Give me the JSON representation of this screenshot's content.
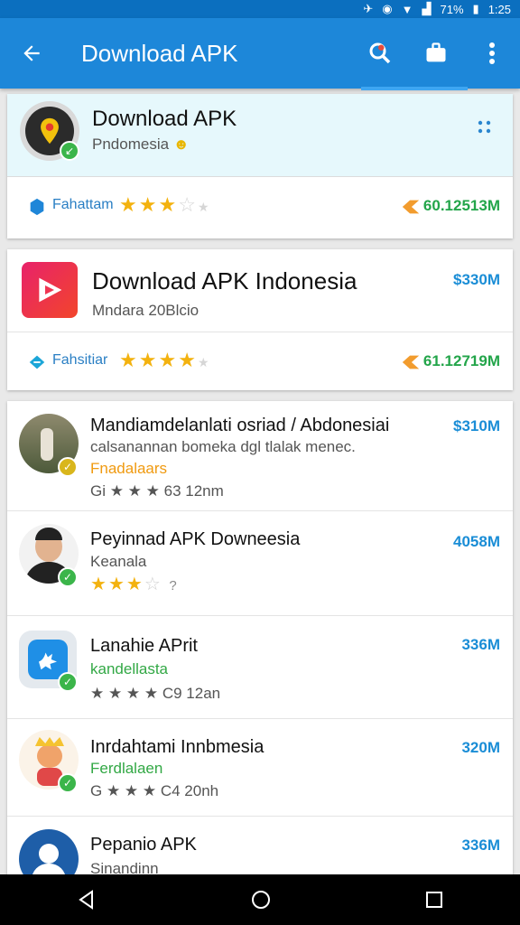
{
  "status_bar": {
    "battery": "71%",
    "time": "1:25"
  },
  "app_bar": {
    "title": "Download APK"
  },
  "featured": [
    {
      "name": "Download APK",
      "subtitle": "Pndomesia",
      "tag": "Fahattam",
      "stars": 3,
      "size": "60.12513M"
    },
    {
      "name": "Download APK Indonesia",
      "subtitle": "Mndara 20Blcio",
      "tag": "Fahsitiar",
      "stars": 4,
      "size_top": "$330M",
      "size": "61.12719M"
    }
  ],
  "list": [
    {
      "title": "Mandiamdelanlati osriad / Abdonesiai",
      "description": "calsanannan bomeka dgl tlalak menec.",
      "tag": "Fnadalaars",
      "meta": "Gi ★ ★ ★ 63 12nm",
      "size": "$310M"
    },
    {
      "title": "Peyinnad APK Downeesia",
      "subtitle": "Keanala",
      "stars": 3,
      "stars_suffix": "?",
      "size": "4058M"
    },
    {
      "title": "Lanahie APrit",
      "tag": "kandellasta",
      "meta": "★ ★ ★ ★ C9 12an",
      "size": "336M"
    },
    {
      "title": "Inrdahtami Innbmesia",
      "tag": "Ferdlalaen",
      "meta": "G ★ ★ ★ C4 20nh",
      "size": "320M"
    },
    {
      "title": "Pepanio APK",
      "subtitle": "Sinandinn",
      "size": "336M"
    }
  ],
  "icons": [
    "back-arrow-icon",
    "search-icon",
    "briefcase-icon",
    "more-vert-icon",
    "grid-dots-icon",
    "back-nav-icon",
    "home-nav-icon",
    "recents-nav-icon"
  ],
  "colors": {
    "app_bar": "#1d87d9",
    "status_bar": "#0b6fbf",
    "star": "#f3b20f",
    "size_green": "#23a54a",
    "size_blue": "#1a8dd6"
  }
}
